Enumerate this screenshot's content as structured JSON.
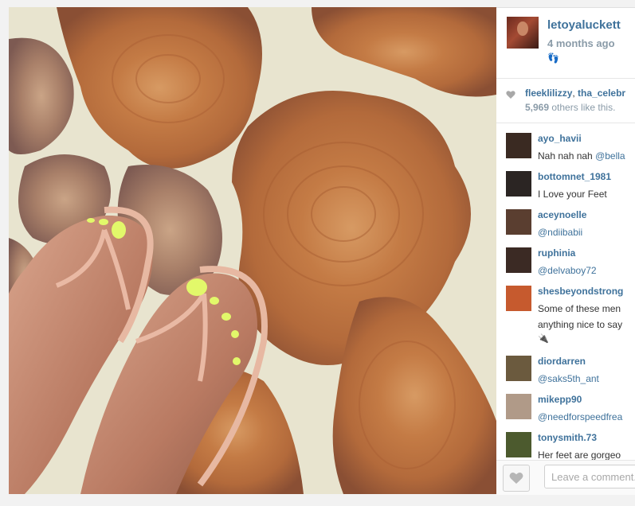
{
  "post": {
    "owner": "letoyaluckett",
    "time": "4 months ago",
    "caption": "👣"
  },
  "likes": {
    "likers_line_1": "fleeklilizzy",
    "likers_sep": ", ",
    "likers_line_2": "tha_celebr",
    "count": "5,969",
    "count_suffix": " others like this."
  },
  "comments": [
    {
      "user": "ayo_havii",
      "text": "Nah nah nah ",
      "mention": "@bella",
      "avatar_color": "#3a2a22"
    },
    {
      "user": "bottomnet_1981",
      "text": "I Love your Feet",
      "mention": "",
      "avatar_color": "#2b2523"
    },
    {
      "user": "aceynoelle",
      "text": "",
      "mention": "@ndiibabii",
      "avatar_color": "#5a3e30"
    },
    {
      "user": "ruphinia",
      "text": "",
      "mention": "@delvaboy72",
      "avatar_color": "#3b2a24"
    },
    {
      "user": "shesbeyondstrong",
      "text": "Some of these men",
      "text2": "anything nice to say",
      "text3": "🔌",
      "mention": "",
      "avatar_color": "#c65a2e"
    },
    {
      "user": "diordarren",
      "text": "",
      "mention": "@saks5th_ant",
      "avatar_color": "#6b5a3e"
    },
    {
      "user": "mikepp90",
      "text": "",
      "mention": "@needforspeedfrea",
      "avatar_color": "#b09a88"
    },
    {
      "user": "tonysmith.73",
      "text": "Her feet are gorgeo",
      "mention": "",
      "avatar_color": "#4c5a2e"
    }
  ],
  "footer": {
    "comment_placeholder": "Leave a comment..."
  },
  "colors": {
    "link": "#3f729b",
    "muted": "#8a9ba8",
    "nail_polish": "#e2f86a"
  }
}
